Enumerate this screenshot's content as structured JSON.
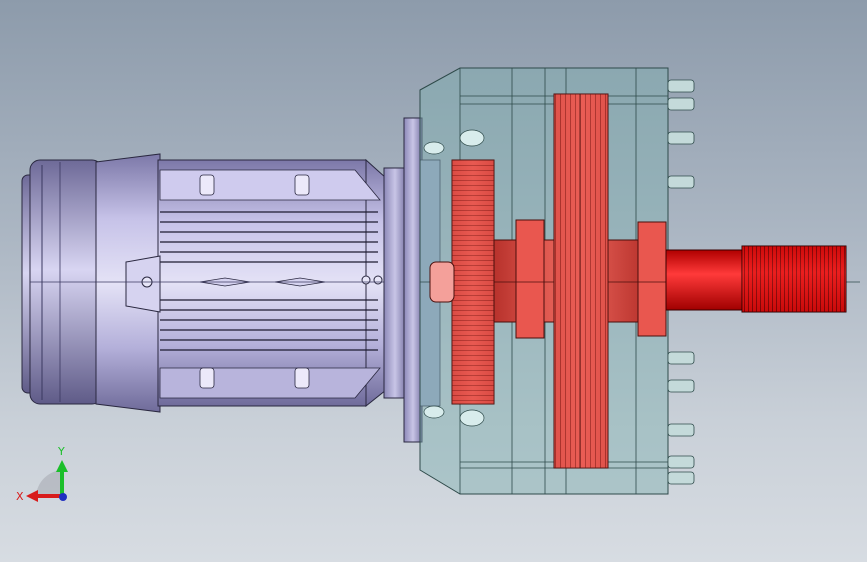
{
  "viewport": {
    "background_top": "#8d9bab",
    "background_bottom": "#d7dce2"
  },
  "model": {
    "motor_color": "#b9b4d8",
    "housing_color": "#9fb8b8",
    "gear_color": "#e0403a",
    "shaft_color": "#ff1a1a"
  },
  "triad": {
    "x_label": "X",
    "y_label": "Y",
    "x_color": "#d81b1b",
    "y_color": "#1bbf2a"
  }
}
